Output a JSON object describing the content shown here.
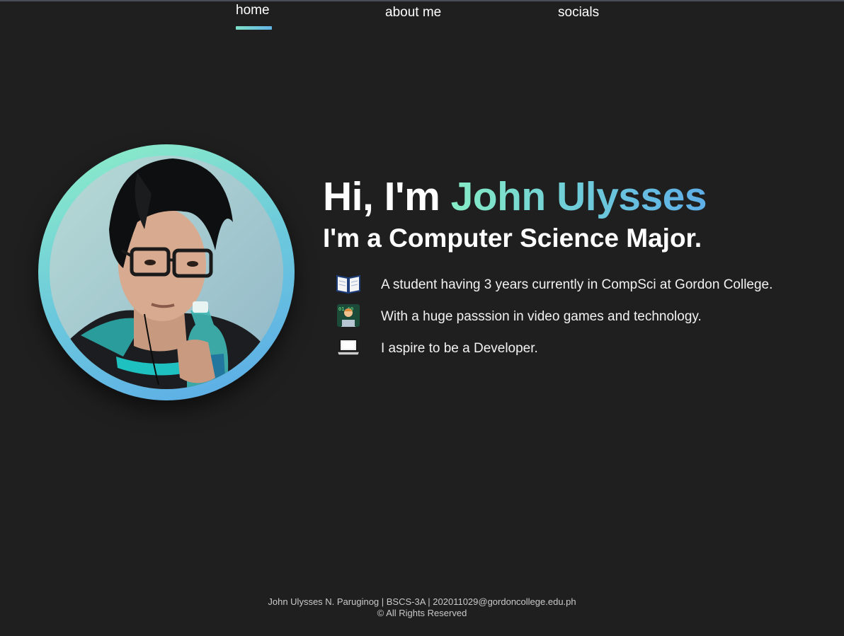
{
  "nav": {
    "items": [
      {
        "label": "home",
        "active": true
      },
      {
        "label": "about me",
        "active": false
      },
      {
        "label": "socials",
        "active": false
      }
    ],
    "accent_gradient": [
      "#7ee0c8",
      "#62b3e6"
    ]
  },
  "hero": {
    "greeting_prefix": "Hi, I'm ",
    "name": "John Ulysses",
    "subtitle": "I'm a Computer Science Major.",
    "profile_photo": "profile-photo"
  },
  "facts": [
    {
      "icon": "open-book-icon",
      "text": "A student having 3 years currently in CompSci at Gordon College."
    },
    {
      "icon": "technologist-icon",
      "text": "With a huge passsion in video games and technology."
    },
    {
      "icon": "laptop-icon",
      "text": "I aspire to be a Developer."
    }
  ],
  "footer": {
    "line1": "John Ulysses N. Paruginog | BSCS-3A | 202011029@gordoncollege.edu.ph",
    "line2": "© All Rights Reserved"
  },
  "colors": {
    "background": "#1f1f1f",
    "text": "#ffffff",
    "gradient_start": "#86ecc4",
    "gradient_end": "#5eaee8"
  }
}
